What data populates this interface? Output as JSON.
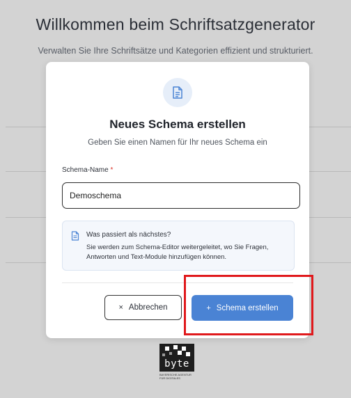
{
  "page": {
    "title": "Willkommen beim Schriftsatzgenerator",
    "subtitle": "Verwalten Sie Ihre Schriftsätze und Kategorien effizient und strukturiert."
  },
  "modal": {
    "icon": "document-icon",
    "title": "Neues Schema erstellen",
    "description": "Geben Sie einen Namen für Ihr neues Schema ein",
    "field": {
      "label": "Schema-Name",
      "required_marker": "*",
      "value": "Demoschema"
    },
    "info": {
      "icon": "document-icon",
      "title": "Was passiert als nächstes?",
      "text": "Sie werden zum Schema-Editor weitergeleitet, wo Sie Fragen, Antworten und Text-Module hinzufügen können."
    },
    "actions": {
      "cancel_icon": "×",
      "cancel_label": "Abbrechen",
      "create_icon": "+",
      "create_label": "Schema erstellen"
    }
  },
  "logo": {
    "text": "byte",
    "subtext": "BAYERISCHE AGENTUR FÜR DIGITALES"
  },
  "colors": {
    "backdrop": "#d3d3d3",
    "accent": "#4a83d4",
    "highlight": "#e0191c",
    "icon_bg": "#e6eef9"
  }
}
